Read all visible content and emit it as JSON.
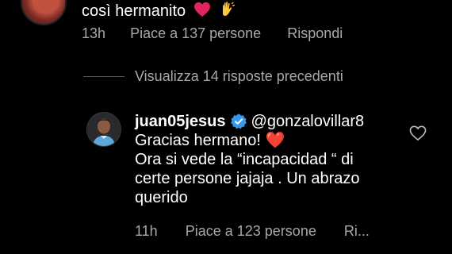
{
  "top_comment": {
    "text": "così hermanito",
    "time": "13h",
    "likes": "Piace a 137 persone",
    "reply": "Rispondi"
  },
  "view_replies": "Visualizza 14 risposte precedenti",
  "reply_comment": {
    "username": "juan05jesus",
    "mention": "@gonzalovillar8",
    "lines": [
      "Gracias hermano! ❤️",
      "Ora si vede la “incapacidad “ di",
      "certe persone jajaja . Un abrazo",
      "querido"
    ],
    "time": "11h",
    "likes": "Piace a 123 persone",
    "reply": "Ri..."
  },
  "colors": {
    "background": "#000000",
    "secondary_text": "#a8a8a8",
    "verified_blue": "#3897f0",
    "heart_red": "#e0245e"
  }
}
